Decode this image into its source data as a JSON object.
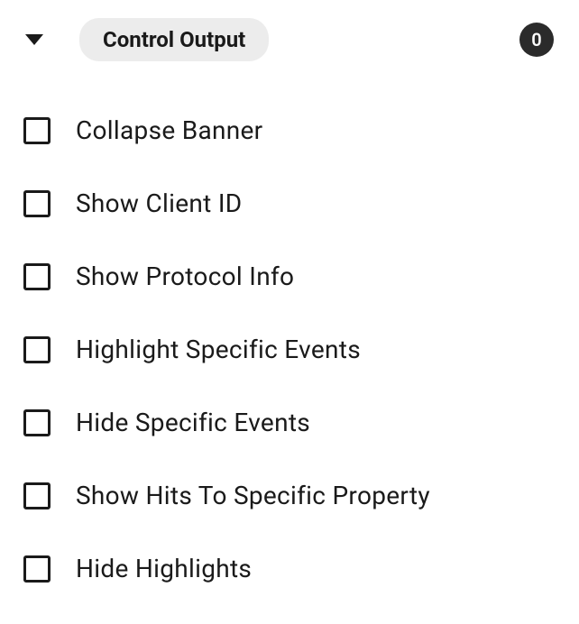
{
  "header": {
    "title": "Control Output",
    "badge": "0"
  },
  "options": [
    {
      "label": "Collapse Banner",
      "checked": false
    },
    {
      "label": "Show Client ID",
      "checked": false
    },
    {
      "label": "Show Protocol Info",
      "checked": false
    },
    {
      "label": "Highlight Specific Events",
      "checked": false
    },
    {
      "label": "Hide Specific Events",
      "checked": false
    },
    {
      "label": "Show Hits To Specific Property",
      "checked": false
    },
    {
      "label": "Hide Highlights",
      "checked": false
    }
  ]
}
